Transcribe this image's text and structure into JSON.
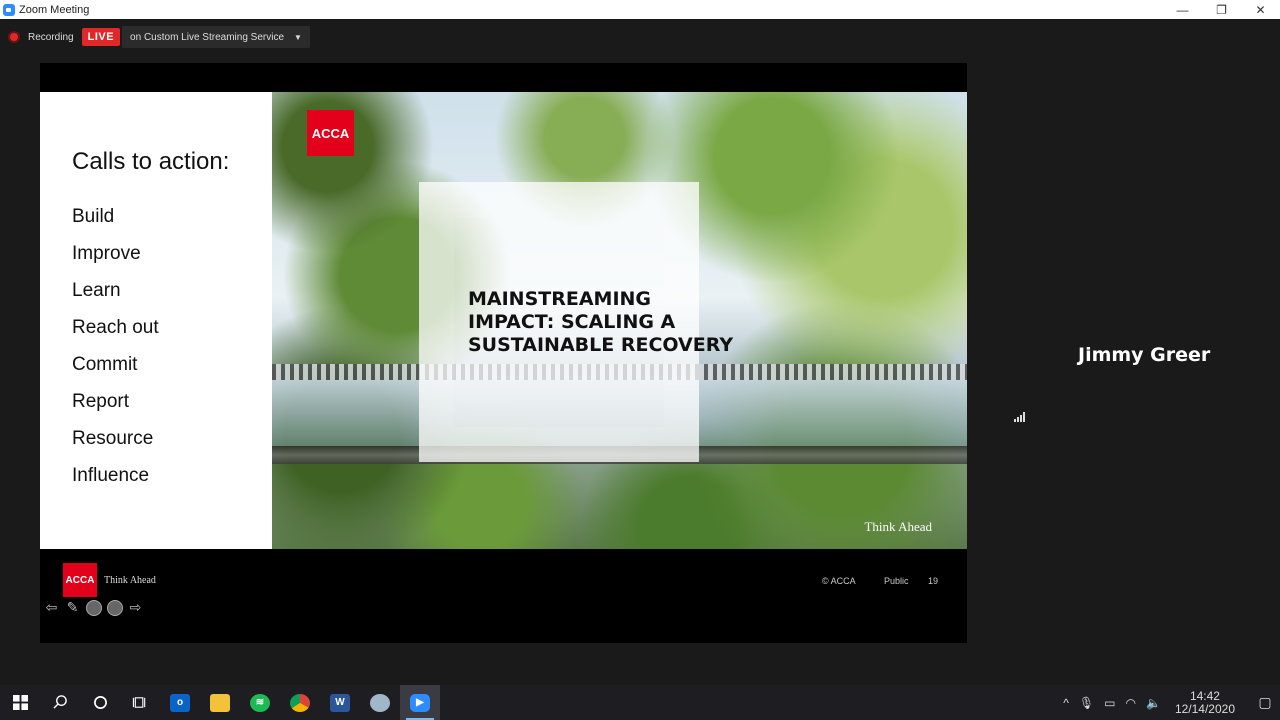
{
  "window": {
    "title": "Zoom Meeting",
    "minimize": "—",
    "restore": "❐",
    "close": "✕"
  },
  "status": {
    "recording_label": "Recording",
    "live_badge": "LIVE",
    "stream_target": "on Custom Live Streaming Service",
    "caret": "▼"
  },
  "slide": {
    "heading": "Calls to action:",
    "items": [
      "Build",
      "Improve",
      "Learn",
      "Reach out",
      "Commit",
      "Report",
      "Resource",
      "Influence"
    ],
    "logo_text": "ACCA",
    "title_lines": [
      "MAINSTREAMING",
      "IMPACT: SCALING A",
      "SUSTAINABLE RECOVERY"
    ],
    "think_ahead": "Think Ahead",
    "footer": {
      "logo_text": "ACCA",
      "think_ahead": "Think Ahead",
      "copyright": "© ACCA",
      "classification": "Public",
      "page_number": "19"
    }
  },
  "participant": {
    "name": "Jimmy Greer"
  },
  "taskbar": {
    "clock_time": "14:42",
    "clock_date": "12/14/2020"
  },
  "colors": {
    "acca_red": "#e3001b",
    "live_red": "#e02828",
    "taskbar": "#1d1d22"
  }
}
